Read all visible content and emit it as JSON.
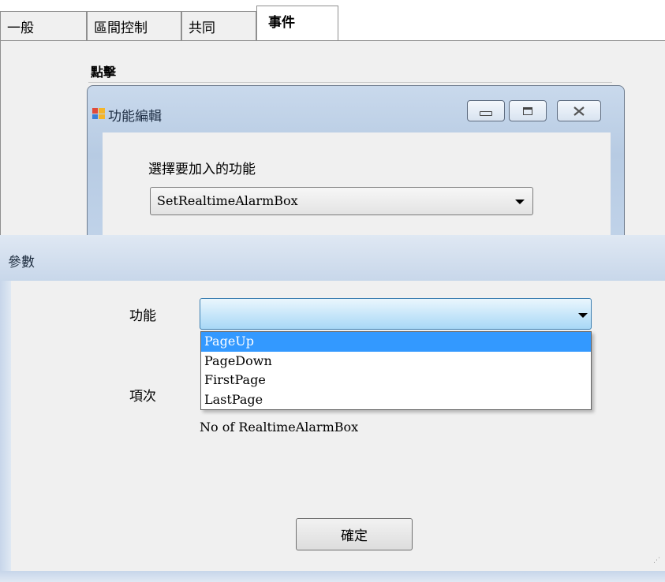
{
  "property_page": {
    "tabs": [
      {
        "label": "一般"
      },
      {
        "label": "區間控制"
      },
      {
        "label": "共同"
      },
      {
        "label": "事件"
      }
    ],
    "section_label": "點擊"
  },
  "function_editor": {
    "title": "功能編輯",
    "prompt": "選擇要加入的功能",
    "selected_function": "SetRealtimeAlarmBox",
    "window_buttons": {
      "minimize": "—",
      "maximize": "□",
      "close": "✕"
    }
  },
  "parameters_dialog": {
    "title": "參數",
    "function_label": "功能",
    "function_value": "",
    "item_label": "項次",
    "dropdown_options": [
      "PageUp",
      "PageDown",
      "FirstPage",
      "LastPage"
    ],
    "selected_option": "PageUp",
    "note": "No of RealtimeAlarmBox",
    "ok_label": "確定"
  },
  "colors": {
    "selection": "#3399ff",
    "focus_border": "#3c7fb1"
  }
}
